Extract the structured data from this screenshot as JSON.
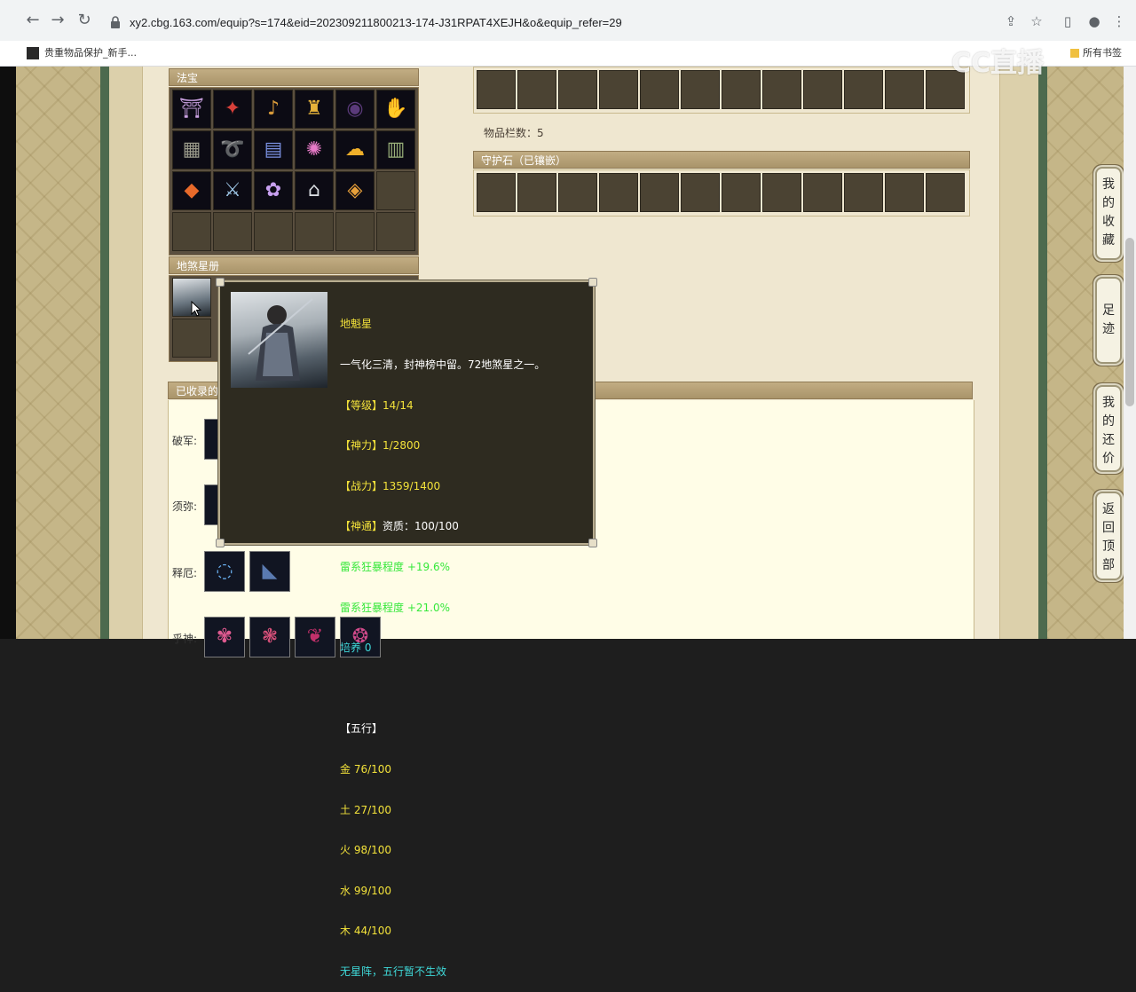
{
  "browser": {
    "url": "xy2.cbg.163.com/equip?s=174&eid=202309211800213-174-J31RPAT4XEJH&o&equip_refer=29",
    "bookmark_1": "贵重物品保护_新手...",
    "bookmark_all": "所有书签",
    "watermark": "CC直播"
  },
  "fabao": {
    "title": "法宝",
    "items": [
      {
        "icon": "magic-lantern-icon",
        "glyph": "⛩",
        "color": "#c9a0e0"
      },
      {
        "icon": "red-fan-icon",
        "glyph": "✦",
        "color": "#d8403a"
      },
      {
        "icon": "pipa-icon",
        "glyph": "♪",
        "color": "#d89a3a"
      },
      {
        "icon": "golden-tower-icon",
        "glyph": "♜",
        "color": "#e6b23a"
      },
      {
        "icon": "dark-orb-icon",
        "glyph": "◉",
        "color": "#5a3a7a"
      },
      {
        "icon": "blue-claw-icon",
        "glyph": "✋",
        "color": "#8fb0e8"
      },
      {
        "icon": "grey-scroll-icon",
        "glyph": "▦",
        "color": "#9a9a8a"
      },
      {
        "icon": "purple-whip-icon",
        "glyph": "➰",
        "color": "#c070d8"
      },
      {
        "icon": "blue-book-icon",
        "glyph": "▤",
        "color": "#7a90e0"
      },
      {
        "icon": "pink-lantern-icon",
        "glyph": "✺",
        "color": "#e87ac8"
      },
      {
        "icon": "golden-cloud-icon",
        "glyph": "☁",
        "color": "#f0b02a"
      },
      {
        "icon": "jade-tablet-icon",
        "glyph": "▥",
        "color": "#9ab07a"
      },
      {
        "icon": "flame-seal-icon",
        "glyph": "◆",
        "color": "#e86a2a"
      },
      {
        "icon": "ice-sword-icon",
        "glyph": "⚔",
        "color": "#9fc8e8"
      },
      {
        "icon": "violet-flower-icon",
        "glyph": "✿",
        "color": "#c8a0f0"
      },
      {
        "icon": "silver-bell-icon",
        "glyph": "⌂",
        "color": "#d8dce0"
      },
      {
        "icon": "amber-gem-icon",
        "glyph": "◈",
        "color": "#e8a03a"
      }
    ]
  },
  "disha": {
    "title": "地煞星册"
  },
  "capacity": {
    "label": "物品栏数：5"
  },
  "guardian": {
    "title": "守护石（已镶嵌）"
  },
  "collected": {
    "title": "已收录的",
    "rows": [
      {
        "label": "破军:",
        "thumbs": [
          {
            "icon": "pojun-card-icon",
            "glyph": "❀",
            "color": "#c84a5a"
          }
        ]
      },
      {
        "label": "须弥:",
        "thumbs": [
          {
            "icon": "xumi-card-icon",
            "glyph": "✧",
            "color": "#8a8ab0"
          }
        ]
      },
      {
        "label": "释厄:",
        "thumbs": [
          {
            "icon": "blue-ring-icon",
            "glyph": "◌",
            "color": "#6ab0f0"
          },
          {
            "icon": "dark-crystal-icon",
            "glyph": "◣",
            "color": "#5a7ab0"
          }
        ]
      },
      {
        "label": "乎神:",
        "thumbs": [
          {
            "icon": "pink-beast-icon",
            "glyph": "✾",
            "color": "#e05a90"
          },
          {
            "icon": "red-mask-icon",
            "glyph": "❃",
            "color": "#d8507a"
          },
          {
            "icon": "crimson-wing-icon",
            "glyph": "❦",
            "color": "#c0306a"
          },
          {
            "icon": "magenta-orb-icon",
            "glyph": "❂",
            "color": "#d04a8a"
          }
        ]
      }
    ]
  },
  "tooltip": {
    "name": "地魁星",
    "desc": "一气化三清，封神榜中留。72地煞星之一。",
    "level": "【等级】14/14",
    "shenli": "【神力】1/2800",
    "zhanli": "【战力】1359/1400",
    "shentong_label": "【神通】",
    "shentong_value": "资质：100/100",
    "attr1": "雷系狂暴程度 +19.6%",
    "attr2": "雷系狂暴程度 +21.0%",
    "peiyang": "培养 0",
    "wuxing_title": "【五行】",
    "jin": "金 76/100",
    "tu": "土 27/100",
    "huo": "火 98/100",
    "shui": "水 99/100",
    "mu": "木 44/100",
    "note": "无星阵，五行暂不生效"
  },
  "sidenav": [
    "我的收藏",
    "足迹",
    "我的还价",
    "返回顶部"
  ],
  "colors": {
    "panel_header": "#b09b70",
    "slot": "#4b4333",
    "tooltip_bg": "#2e2b20",
    "tooltip_yellow": "#f3e23a",
    "tooltip_green": "#35e83a",
    "tooltip_cyan": "#3fd9d9"
  }
}
